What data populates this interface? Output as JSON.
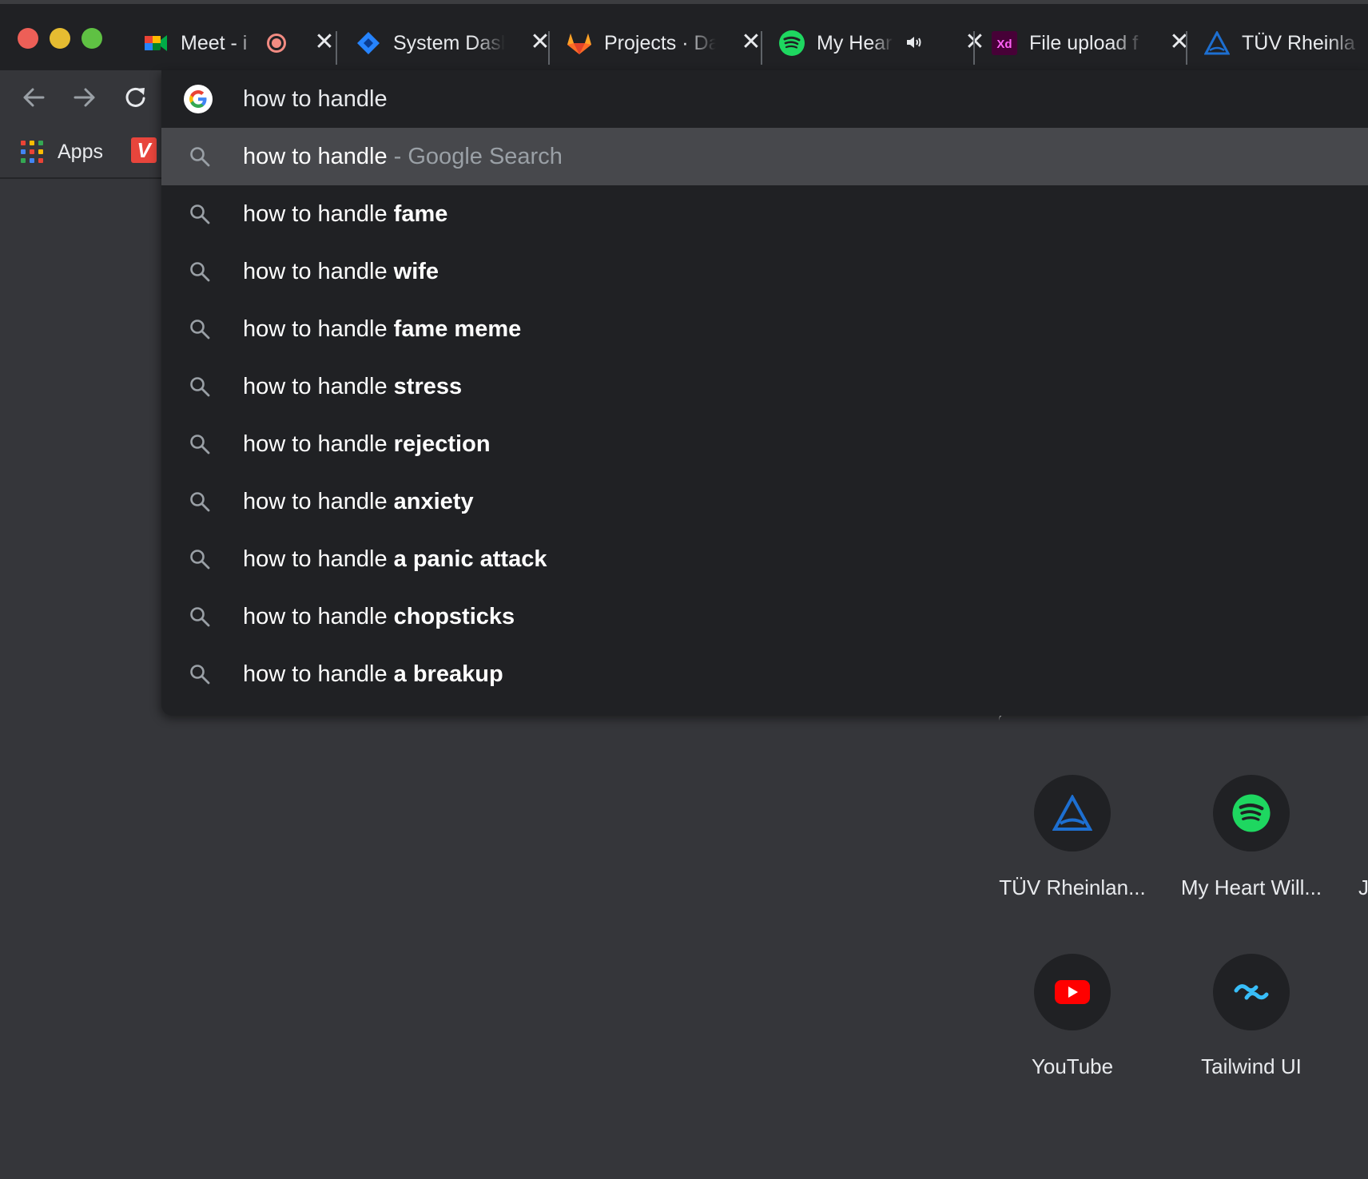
{
  "tabs": [
    {
      "title": "Meet - i",
      "favicon": "google-meet-icon",
      "indicator": "recording-icon",
      "close": "✕"
    },
    {
      "title": "System Dash",
      "favicon": "jira-icon",
      "close": "✕"
    },
    {
      "title": "Projects · Da",
      "favicon": "gitlab-icon",
      "close": "✕"
    },
    {
      "title": "My Heart",
      "favicon": "spotify-icon",
      "indicator": "audio-playing-icon",
      "close": "✕"
    },
    {
      "title": "File upload f",
      "favicon": "adobe-xd-icon",
      "close": "✕"
    },
    {
      "title": "TÜV Rheinla",
      "favicon": "tuv-icon"
    }
  ],
  "bookmarks": {
    "apps_label": "Apps",
    "apps_colors": [
      "#ea4335",
      "#fbbc04",
      "#34a853",
      "#4285f4",
      "#ea4335",
      "#fbbc04",
      "#34a853",
      "#4285f4",
      "#ea4335"
    ]
  },
  "omnibox": {
    "input_value": "how to handle",
    "suggestions": [
      {
        "prefix": "how to handle",
        "bold": "",
        "separator": " - ",
        "suffix": "Google Search",
        "selected": true
      },
      {
        "prefix": "how to handle ",
        "bold": "fame"
      },
      {
        "prefix": "how to handle ",
        "bold": "wife"
      },
      {
        "prefix": "how to handle ",
        "bold": "fame meme"
      },
      {
        "prefix": "how to handle ",
        "bold": "stress"
      },
      {
        "prefix": "how to handle ",
        "bold": "rejection"
      },
      {
        "prefix": "how to handle ",
        "bold": "anxiety"
      },
      {
        "prefix": "how to handle ",
        "bold": "a panic attack"
      },
      {
        "prefix": "how to handle ",
        "bold": "chopsticks"
      },
      {
        "prefix": "how to handle ",
        "bold": "a breakup"
      }
    ]
  },
  "shortcuts": [
    {
      "label": "TÜV Rheinlan...",
      "icon": "tuv-icon"
    },
    {
      "label": "My Heart Will...",
      "icon": "spotify-icon"
    },
    {
      "label": "YouTube",
      "icon": "youtube-icon"
    },
    {
      "label": "Tailwind UI",
      "icon": "tailwind-icon"
    }
  ],
  "cut_shortcut_letter": "J",
  "colors": {
    "tabstrip": "#202124",
    "toolbar": "#35363a",
    "dropdown": "#202124",
    "selected_row": "#47484c",
    "spotify": "#1ed760",
    "youtube": "#ff0000",
    "tailwind": "#38bdf8"
  }
}
